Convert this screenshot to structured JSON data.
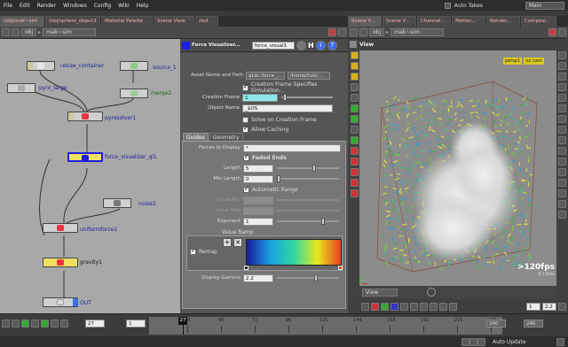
{
  "menubar": {
    "items": [
      "File",
      "Edit",
      "Render",
      "Windows",
      "Config",
      "Wiki",
      "Help"
    ],
    "auto_takes": "Auto Takes",
    "desktop": "Main"
  },
  "left_tabs": [
    "/obj/mak~sim",
    "/obj/sphere_object1",
    "Material Palette",
    "Scene View",
    "/out"
  ],
  "left_path": {
    "context": "obj",
    "node": "mak~sim"
  },
  "right_tabs": [
    "Scene V...",
    "Scene V...",
    "Channel...",
    "Motion...",
    "Render...",
    "Composi..."
  ],
  "right_path": {
    "context": "obj",
    "node": "mak~sim"
  },
  "network_nodes": [
    {
      "name": "resize_container"
    },
    {
      "name": "source_1"
    },
    {
      "name": "pyro_large"
    },
    {
      "name": "merge2"
    },
    {
      "name": "pyrosolver1"
    },
    {
      "name": "force_visualizer_ql1"
    },
    {
      "name": "noise2"
    },
    {
      "name": "uniformforce1"
    },
    {
      "name": "gravity1"
    },
    {
      "name": "OUT"
    }
  ],
  "params": {
    "node_type": "Force Visualizer...",
    "node_name": "force_visual1",
    "asset_label": "Asset Name and Path",
    "asset_name": "qLib::force_...",
    "asset_path": "/home/tusi/...",
    "creation_frame_checkbox": "Creation Frame Specifies Simulation...",
    "creation_frame_label": "Creation Frame",
    "creation_frame_value": "1",
    "object_name_label": "Object Name",
    "object_name_value": "_$OS",
    "solve_on_creation": "Solve on Creation Frame",
    "allow_caching": "Allow Caching",
    "tabs": [
      "Guides",
      "Geometry"
    ],
    "forces_label": "Forces to Display",
    "forces_value": "*",
    "faded_ends": "Faded Ends",
    "length_label": "Length",
    "length_value": "5",
    "min_length_label": "Min Length",
    "min_length_value": "0",
    "auto_range": "Automatic Range",
    "value_min_label": "Value Min",
    "value_max_label": "Value Max",
    "exponent_label": "Exponent",
    "exponent_value": "1",
    "value_ramp_label": "Value Ramp",
    "remap_label": "Remap",
    "display_gamma_label": "Display Gamma",
    "display_gamma_value": "2.2"
  },
  "viewport": {
    "title": "View",
    "persp": "persp1",
    "cam": "no cam",
    "fps": ">120fps",
    "ms": "8.10ms",
    "view_menu": "View",
    "gamma_value": "2.2",
    "ratio_value": "1"
  },
  "timeline": {
    "current_frame": "27",
    "start_frame": "1",
    "marker": "27",
    "ticks": [
      "24",
      "48",
      "72",
      "96",
      "120",
      "144",
      "168",
      "192",
      "216",
      "240"
    ],
    "end_left": "240",
    "end_right": "240"
  },
  "status": {
    "auto_update": "Auto Update"
  },
  "colors": {
    "selected_node": "#1e1ee0",
    "tab_red_text": "#ffb0b0",
    "accent_green": "#3cc83c"
  }
}
